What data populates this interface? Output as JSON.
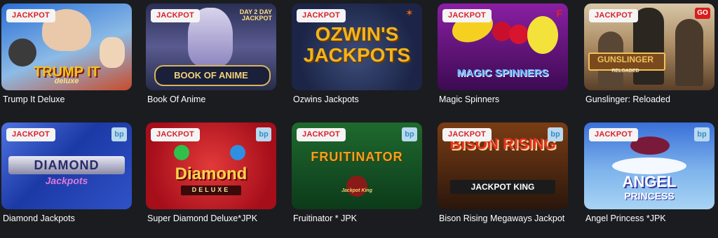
{
  "games": [
    {
      "title": "Trump It Deluxe",
      "badge": "JACKPOT",
      "art_main": "TRUMP IT",
      "art_sub": "deluxe",
      "bg1": "#2a6fd6",
      "bg2": "#b8d8f0",
      "art_color": "#f3c21c"
    },
    {
      "title": "Book Of Anime",
      "badge": "JACKPOT",
      "art_main": "BOOK OF ANIME",
      "art_sub": "DAY 2 DAY JACKPOT",
      "bg1": "#262c4a",
      "bg2": "#8b84b8",
      "art_color": "#f1d27a"
    },
    {
      "title": "Ozwins Jackpots",
      "badge": "JACKPOT",
      "art_main": "OZWIN'S",
      "art_sub": "JACKPOTS",
      "bg1": "#1c2547",
      "bg2": "#3c4d7a",
      "art_color": "#f2b41b"
    },
    {
      "title": "Magic Spinners",
      "badge": "JACKPOT",
      "art_main": "MAGIC SPINNERS",
      "art_sub": "",
      "bg1": "#3d0a52",
      "bg2": "#8a1fa3",
      "art_color": "#5bb0ff"
    },
    {
      "title": "Gunslinger: Reloaded",
      "badge": "JACKPOT",
      "art_main": "GUNSLINGER",
      "art_sub": "RELOADED",
      "bg1": "#c9b79a",
      "bg2": "#6e5337",
      "art_color": "#f0c35a"
    },
    {
      "title": "Diamond Jackpots",
      "badge": "JACKPOT",
      "art_main": "DIAMOND",
      "art_sub": "Jackpots",
      "bg1": "#1c3aa6",
      "bg2": "#4e73e0",
      "art_color": "#dcd6ff",
      "provider": "bp"
    },
    {
      "title": "Super Diamond Deluxe*JPK",
      "badge": "JACKPOT",
      "art_main": "Diamond",
      "art_sub": "DELUXE",
      "bg1": "#a60e1a",
      "bg2": "#e23a3a",
      "art_color": "#ffd34a",
      "provider": "bp"
    },
    {
      "title": "Fruitinator * JPK",
      "badge": "JACKPOT",
      "art_main": "FRUITINATOR",
      "art_sub": "Jackpot King",
      "bg1": "#0c3a1a",
      "bg2": "#1f6a2e",
      "art_color": "#f0a21c",
      "provider": "bp"
    },
    {
      "title": "Bison Rising Megaways Jackpot",
      "badge": "JACKPOT",
      "art_main": "BISON RISING",
      "art_sub": "JACKPOT KING",
      "bg1": "#2a160c",
      "bg2": "#7a3d14",
      "art_color": "#e8321e",
      "provider": "bp"
    },
    {
      "title": "Angel Princess *JPK",
      "badge": "JACKPOT",
      "art_main": "ANGEL",
      "art_sub": "PRINCESS",
      "bg1": "#3a6fd8",
      "bg2": "#a8d4f4",
      "art_color": "#ffffff",
      "provider": "bp"
    }
  ]
}
